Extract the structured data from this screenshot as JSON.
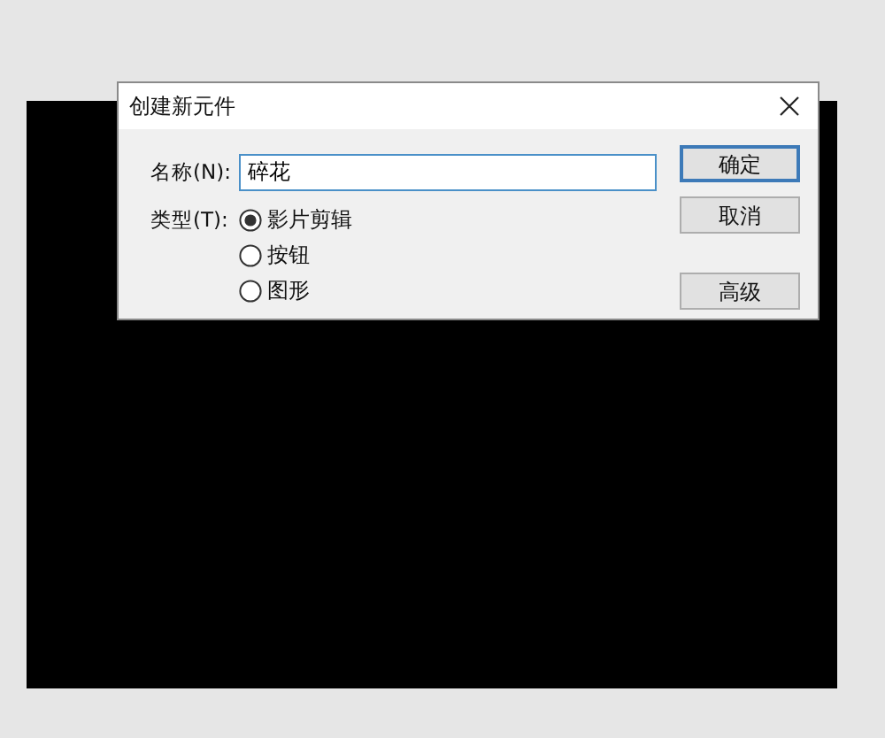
{
  "dialog": {
    "title": "创建新元件",
    "name_label": "名称(N):",
    "name_value": "碎花",
    "type_label": "类型(T):",
    "types": [
      {
        "label": "影片剪辑",
        "selected": true
      },
      {
        "label": "按钮",
        "selected": false
      },
      {
        "label": "图形",
        "selected": false
      }
    ],
    "buttons": [
      {
        "label": "确定",
        "kind": "default"
      },
      {
        "label": "取消",
        "kind": "normal"
      },
      {
        "label": "高级",
        "kind": "spaced"
      }
    ]
  }
}
